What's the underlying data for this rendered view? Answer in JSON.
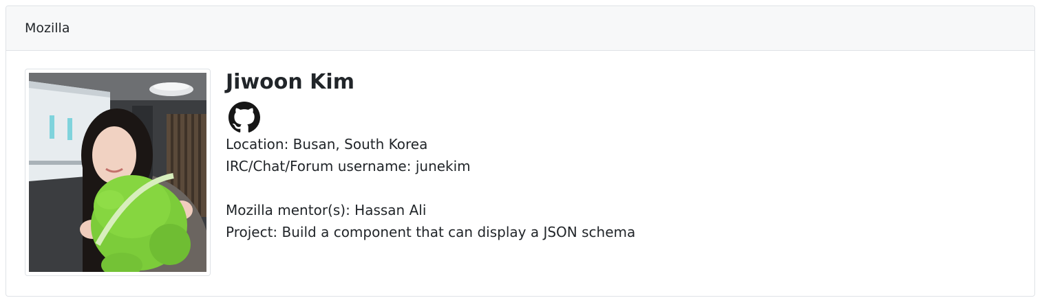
{
  "card": {
    "header_title": "Mozilla"
  },
  "profile": {
    "name": "Jiwoon Kim",
    "github_icon": "github-icon",
    "location_label": "Location: Busan, South Korea",
    "username_label": "IRC/Chat/Forum username: junekim",
    "mentor_label": "Mozilla mentor(s): Hassan Ali",
    "project_label": "Project: Build a component that can display a JSON schema"
  }
}
